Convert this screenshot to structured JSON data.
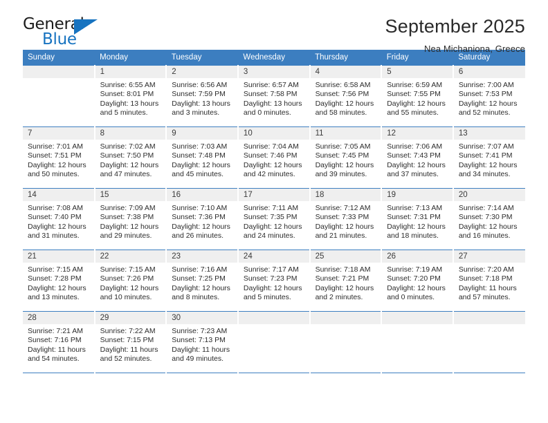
{
  "brand": {
    "name_part1": "General",
    "name_part2": "Blue",
    "triangle_icon": "blue-triangle-icon",
    "accent_color": "#1773c0"
  },
  "header": {
    "title": "September 2025",
    "location": "Nea Michaniona, Greece"
  },
  "colors": {
    "header_blue": "#3c7ec0",
    "daynum_band": "#efefef",
    "text": "#2b2b2b"
  },
  "weekdays": [
    "Sunday",
    "Monday",
    "Tuesday",
    "Wednesday",
    "Thursday",
    "Friday",
    "Saturday"
  ],
  "weeks": [
    [
      {
        "day": ""
      },
      {
        "day": "1",
        "sunrise": "Sunrise: 6:55 AM",
        "sunset": "Sunset: 8:01 PM",
        "daylight": "Daylight: 13 hours and 5 minutes."
      },
      {
        "day": "2",
        "sunrise": "Sunrise: 6:56 AM",
        "sunset": "Sunset: 7:59 PM",
        "daylight": "Daylight: 13 hours and 3 minutes."
      },
      {
        "day": "3",
        "sunrise": "Sunrise: 6:57 AM",
        "sunset": "Sunset: 7:58 PM",
        "daylight": "Daylight: 13 hours and 0 minutes."
      },
      {
        "day": "4",
        "sunrise": "Sunrise: 6:58 AM",
        "sunset": "Sunset: 7:56 PM",
        "daylight": "Daylight: 12 hours and 58 minutes."
      },
      {
        "day": "5",
        "sunrise": "Sunrise: 6:59 AM",
        "sunset": "Sunset: 7:55 PM",
        "daylight": "Daylight: 12 hours and 55 minutes."
      },
      {
        "day": "6",
        "sunrise": "Sunrise: 7:00 AM",
        "sunset": "Sunset: 7:53 PM",
        "daylight": "Daylight: 12 hours and 52 minutes."
      }
    ],
    [
      {
        "day": "7",
        "sunrise": "Sunrise: 7:01 AM",
        "sunset": "Sunset: 7:51 PM",
        "daylight": "Daylight: 12 hours and 50 minutes."
      },
      {
        "day": "8",
        "sunrise": "Sunrise: 7:02 AM",
        "sunset": "Sunset: 7:50 PM",
        "daylight": "Daylight: 12 hours and 47 minutes."
      },
      {
        "day": "9",
        "sunrise": "Sunrise: 7:03 AM",
        "sunset": "Sunset: 7:48 PM",
        "daylight": "Daylight: 12 hours and 45 minutes."
      },
      {
        "day": "10",
        "sunrise": "Sunrise: 7:04 AM",
        "sunset": "Sunset: 7:46 PM",
        "daylight": "Daylight: 12 hours and 42 minutes."
      },
      {
        "day": "11",
        "sunrise": "Sunrise: 7:05 AM",
        "sunset": "Sunset: 7:45 PM",
        "daylight": "Daylight: 12 hours and 39 minutes."
      },
      {
        "day": "12",
        "sunrise": "Sunrise: 7:06 AM",
        "sunset": "Sunset: 7:43 PM",
        "daylight": "Daylight: 12 hours and 37 minutes."
      },
      {
        "day": "13",
        "sunrise": "Sunrise: 7:07 AM",
        "sunset": "Sunset: 7:41 PM",
        "daylight": "Daylight: 12 hours and 34 minutes."
      }
    ],
    [
      {
        "day": "14",
        "sunrise": "Sunrise: 7:08 AM",
        "sunset": "Sunset: 7:40 PM",
        "daylight": "Daylight: 12 hours and 31 minutes."
      },
      {
        "day": "15",
        "sunrise": "Sunrise: 7:09 AM",
        "sunset": "Sunset: 7:38 PM",
        "daylight": "Daylight: 12 hours and 29 minutes."
      },
      {
        "day": "16",
        "sunrise": "Sunrise: 7:10 AM",
        "sunset": "Sunset: 7:36 PM",
        "daylight": "Daylight: 12 hours and 26 minutes."
      },
      {
        "day": "17",
        "sunrise": "Sunrise: 7:11 AM",
        "sunset": "Sunset: 7:35 PM",
        "daylight": "Daylight: 12 hours and 24 minutes."
      },
      {
        "day": "18",
        "sunrise": "Sunrise: 7:12 AM",
        "sunset": "Sunset: 7:33 PM",
        "daylight": "Daylight: 12 hours and 21 minutes."
      },
      {
        "day": "19",
        "sunrise": "Sunrise: 7:13 AM",
        "sunset": "Sunset: 7:31 PM",
        "daylight": "Daylight: 12 hours and 18 minutes."
      },
      {
        "day": "20",
        "sunrise": "Sunrise: 7:14 AM",
        "sunset": "Sunset: 7:30 PM",
        "daylight": "Daylight: 12 hours and 16 minutes."
      }
    ],
    [
      {
        "day": "21",
        "sunrise": "Sunrise: 7:15 AM",
        "sunset": "Sunset: 7:28 PM",
        "daylight": "Daylight: 12 hours and 13 minutes."
      },
      {
        "day": "22",
        "sunrise": "Sunrise: 7:15 AM",
        "sunset": "Sunset: 7:26 PM",
        "daylight": "Daylight: 12 hours and 10 minutes."
      },
      {
        "day": "23",
        "sunrise": "Sunrise: 7:16 AM",
        "sunset": "Sunset: 7:25 PM",
        "daylight": "Daylight: 12 hours and 8 minutes."
      },
      {
        "day": "24",
        "sunrise": "Sunrise: 7:17 AM",
        "sunset": "Sunset: 7:23 PM",
        "daylight": "Daylight: 12 hours and 5 minutes."
      },
      {
        "day": "25",
        "sunrise": "Sunrise: 7:18 AM",
        "sunset": "Sunset: 7:21 PM",
        "daylight": "Daylight: 12 hours and 2 minutes."
      },
      {
        "day": "26",
        "sunrise": "Sunrise: 7:19 AM",
        "sunset": "Sunset: 7:20 PM",
        "daylight": "Daylight: 12 hours and 0 minutes."
      },
      {
        "day": "27",
        "sunrise": "Sunrise: 7:20 AM",
        "sunset": "Sunset: 7:18 PM",
        "daylight": "Daylight: 11 hours and 57 minutes."
      }
    ],
    [
      {
        "day": "28",
        "sunrise": "Sunrise: 7:21 AM",
        "sunset": "Sunset: 7:16 PM",
        "daylight": "Daylight: 11 hours and 54 minutes."
      },
      {
        "day": "29",
        "sunrise": "Sunrise: 7:22 AM",
        "sunset": "Sunset: 7:15 PM",
        "daylight": "Daylight: 11 hours and 52 minutes."
      },
      {
        "day": "30",
        "sunrise": "Sunrise: 7:23 AM",
        "sunset": "Sunset: 7:13 PM",
        "daylight": "Daylight: 11 hours and 49 minutes."
      },
      {
        "day": ""
      },
      {
        "day": ""
      },
      {
        "day": ""
      },
      {
        "day": ""
      }
    ]
  ]
}
